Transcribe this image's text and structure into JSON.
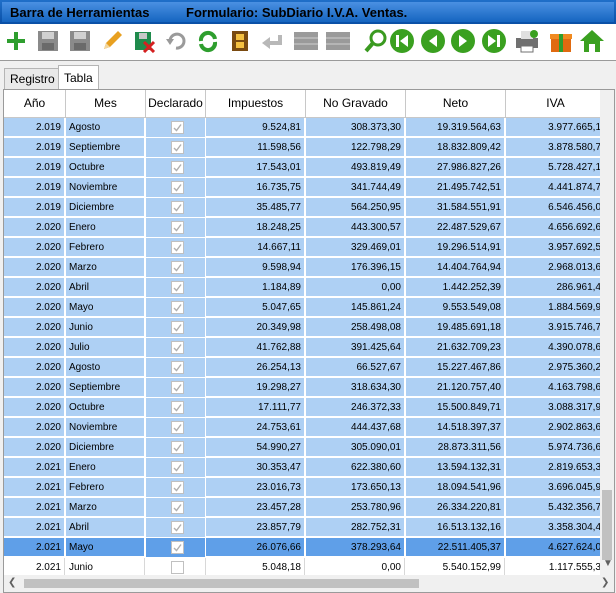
{
  "title": {
    "left": "Barra de Herramientas",
    "right": "Formulario: SubDiario I.V.A. Ventas."
  },
  "toolbar": [
    "add-icon",
    "save-icon",
    "save-as-icon",
    "edit-icon",
    "delete-icon",
    "undo-icon",
    "refresh-icon",
    "film-icon",
    "back-arrow-icon",
    "grid-icon",
    "grid2-icon",
    "search-icon",
    "first-icon",
    "prev-icon",
    "next-icon",
    "last-icon",
    "print-icon",
    "gift-icon",
    "home-icon"
  ],
  "tabs": [
    {
      "label": "Registro"
    },
    {
      "label": "Tabla"
    }
  ],
  "columns": [
    "Año",
    "Mes",
    "Declarado",
    "Impuestos",
    "No Gravado",
    "Neto",
    "IVA"
  ],
  "rows": [
    {
      "anio": "2.019",
      "mes": "Agosto",
      "decl": true,
      "imp": "9.524,81",
      "nog": "308.373,30",
      "neto": "19.319.564,63",
      "iva": "3.977.665,1"
    },
    {
      "anio": "2.019",
      "mes": "Septiembre",
      "decl": true,
      "imp": "11.598,56",
      "nog": "122.798,29",
      "neto": "18.832.809,42",
      "iva": "3.878.580,7"
    },
    {
      "anio": "2.019",
      "mes": "Octubre",
      "decl": true,
      "imp": "17.543,01",
      "nog": "493.819,49",
      "neto": "27.986.827,26",
      "iva": "5.728.427,1"
    },
    {
      "anio": "2.019",
      "mes": "Noviembre",
      "decl": true,
      "imp": "16.735,75",
      "nog": "341.744,49",
      "neto": "21.495.742,51",
      "iva": "4.441.874,7"
    },
    {
      "anio": "2.019",
      "mes": "Diciembre",
      "decl": true,
      "imp": "35.485,77",
      "nog": "564.250,95",
      "neto": "31.584.551,91",
      "iva": "6.546.456,0"
    },
    {
      "anio": "2.020",
      "mes": "Enero",
      "decl": true,
      "imp": "18.248,25",
      "nog": "443.300,57",
      "neto": "22.487.529,67",
      "iva": "4.656.692,6"
    },
    {
      "anio": "2.020",
      "mes": "Febrero",
      "decl": true,
      "imp": "14.667,11",
      "nog": "329.469,01",
      "neto": "19.296.514,91",
      "iva": "3.957.692,5"
    },
    {
      "anio": "2.020",
      "mes": "Marzo",
      "decl": true,
      "imp": "9.598,94",
      "nog": "176.396,15",
      "neto": "14.404.764,94",
      "iva": "2.968.013,6"
    },
    {
      "anio": "2.020",
      "mes": "Abril",
      "decl": true,
      "imp": "1.184,89",
      "nog": "0,00",
      "neto": "1.442.252,39",
      "iva": "286.961,4"
    },
    {
      "anio": "2.020",
      "mes": "Mayo",
      "decl": true,
      "imp": "5.047,65",
      "nog": "145.861,24",
      "neto": "9.553.549,08",
      "iva": "1.884.569,9"
    },
    {
      "anio": "2.020",
      "mes": "Junio",
      "decl": true,
      "imp": "20.349,98",
      "nog": "258.498,08",
      "neto": "19.485.691,18",
      "iva": "3.915.746,7"
    },
    {
      "anio": "2.020",
      "mes": "Julio",
      "decl": true,
      "imp": "41.762,88",
      "nog": "391.425,64",
      "neto": "21.632.709,23",
      "iva": "4.390.078,6"
    },
    {
      "anio": "2.020",
      "mes": "Agosto",
      "decl": true,
      "imp": "26.254,13",
      "nog": "66.527,67",
      "neto": "15.227.467,86",
      "iva": "2.975.360,2"
    },
    {
      "anio": "2.020",
      "mes": "Septiembre",
      "decl": true,
      "imp": "19.298,27",
      "nog": "318.634,30",
      "neto": "21.120.757,40",
      "iva": "4.163.798,6"
    },
    {
      "anio": "2.020",
      "mes": "Octubre",
      "decl": true,
      "imp": "17.111,77",
      "nog": "246.372,33",
      "neto": "15.500.849,71",
      "iva": "3.088.317,9"
    },
    {
      "anio": "2.020",
      "mes": "Noviembre",
      "decl": true,
      "imp": "24.753,61",
      "nog": "444.437,68",
      "neto": "14.518.397,37",
      "iva": "2.902.863,6"
    },
    {
      "anio": "2.020",
      "mes": "Diciembre",
      "decl": true,
      "imp": "54.990,27",
      "nog": "305.090,01",
      "neto": "28.873.311,56",
      "iva": "5.974.736,6"
    },
    {
      "anio": "2.021",
      "mes": "Enero",
      "decl": true,
      "imp": "30.353,47",
      "nog": "622.380,60",
      "neto": "13.594.132,31",
      "iva": "2.819.653,3"
    },
    {
      "anio": "2.021",
      "mes": "Febrero",
      "decl": true,
      "imp": "23.016,73",
      "nog": "173.650,13",
      "neto": "18.094.541,96",
      "iva": "3.696.045,9"
    },
    {
      "anio": "2.021",
      "mes": "Marzo",
      "decl": true,
      "imp": "23.457,28",
      "nog": "253.780,96",
      "neto": "26.334.220,81",
      "iva": "5.432.356,7"
    },
    {
      "anio": "2.021",
      "mes": "Abril",
      "decl": true,
      "imp": "23.857,79",
      "nog": "282.752,31",
      "neto": "16.513.132,16",
      "iva": "3.358.304,4"
    },
    {
      "anio": "2.021",
      "mes": "Mayo",
      "decl": true,
      "imp": "26.076,66",
      "nog": "378.293,64",
      "neto": "22.511.405,37",
      "iva": "4.627.624,0",
      "selected": true
    },
    {
      "anio": "2.021",
      "mes": "Junio",
      "decl": false,
      "imp": "5.048,18",
      "nog": "0,00",
      "neto": "5.540.152,99",
      "iva": "1.117.555,3",
      "plain": true
    }
  ]
}
